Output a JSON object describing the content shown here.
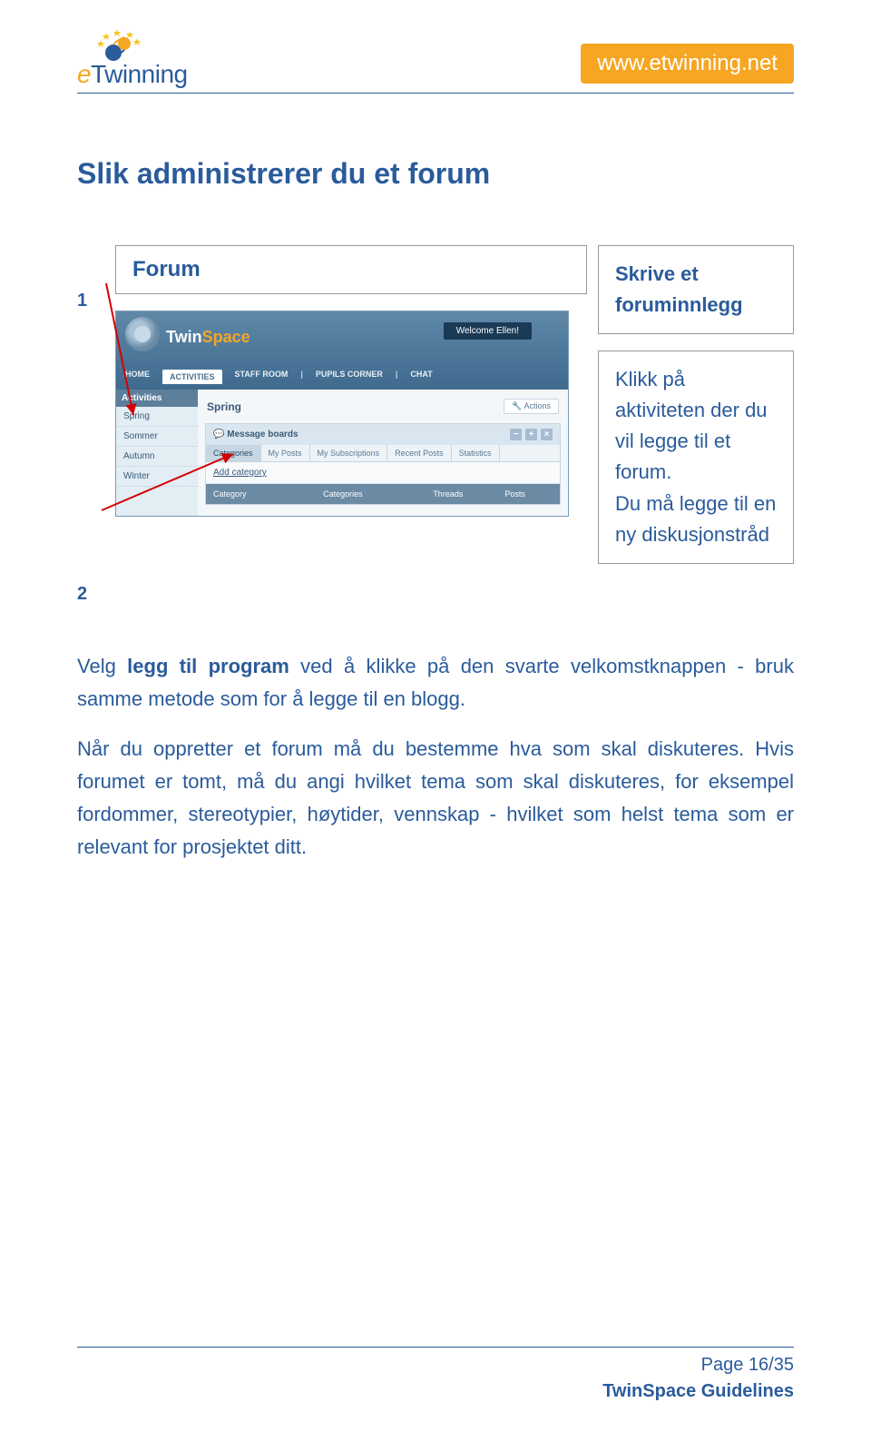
{
  "header": {
    "logo_text_prefix": "e",
    "logo_text_rest": "Twinning",
    "url_badge": "www.etwinning.net"
  },
  "title": "Slik administrerer du et forum",
  "left_markers": {
    "one": "1",
    "two": "2"
  },
  "table": {
    "forum_label": "Forum",
    "right_title": "Skrive et foruminnlegg",
    "right_body": "Klikk på aktiviteten der du vil legge til et forum.\nDu må legge til en ny diskusjonstråd"
  },
  "paragraphs": {
    "p1_prefix": "Velg ",
    "p1_bold": "legg til program",
    "p1_rest": " ved å klikke på den svarte velkomstknappen - bruk samme metode som for å legge til en blogg.",
    "p2": "Når du oppretter et forum må du bestemme hva som skal diskuteres. Hvis forumet er tomt, må du angi hvilket tema som skal diskuteres, for eksempel fordommer, stereotypier, høytider, vennskap - hvilket som helst tema som er relevant for prosjektet ditt."
  },
  "screenshot": {
    "sitename_twin": "Twin",
    "sitename_space": "Space",
    "welcome": "Welcome Ellen!",
    "nav": {
      "home": "HOME",
      "activities": "ACTIVITIES",
      "staff": "STAFF ROOM",
      "pupils": "PUPILS CORNER",
      "chat": "CHAT"
    },
    "sidebar": {
      "header": "Activities",
      "items": [
        "Spring",
        "Sommer",
        "Autumn",
        "Winter"
      ]
    },
    "main": {
      "title": "Spring",
      "actions": "Actions",
      "board_title": "Message boards",
      "tabs": [
        "Categories",
        "My Posts",
        "My Subscriptions",
        "Recent Posts",
        "Statistics"
      ],
      "add_category": "Add category",
      "columns": [
        "Category",
        "Categories",
        "Threads",
        "Posts"
      ]
    }
  },
  "footer": {
    "page": "Page 16/35",
    "guidelines": "TwinSpace Guidelines"
  }
}
